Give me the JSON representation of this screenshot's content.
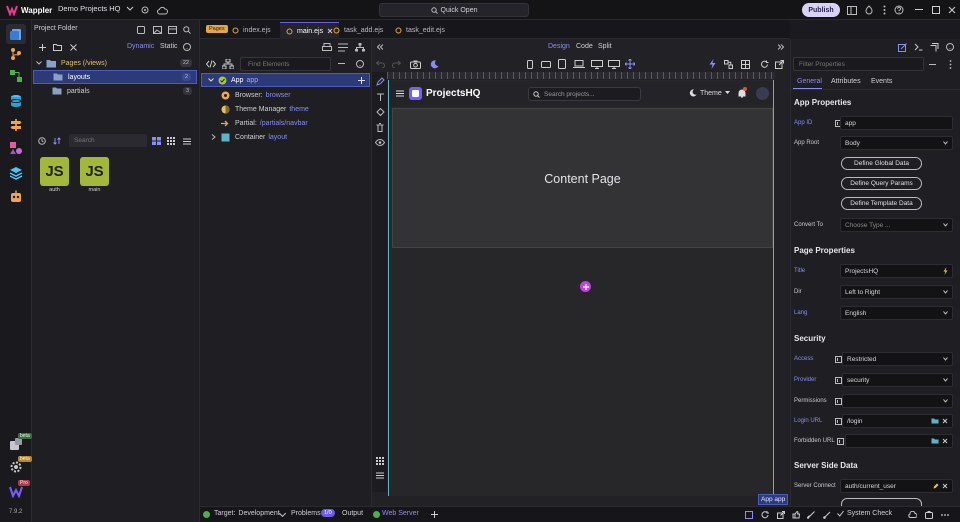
{
  "app": {
    "name": "Wappler",
    "project": "Demo Projects HQ",
    "quick_open": "Quick Open",
    "publish": "Publish",
    "version": "7.9.2"
  },
  "badges": {
    "beta1": "beta",
    "beta2": "beta",
    "pro": "Pro"
  },
  "project_panel": {
    "title": "Project Folder",
    "mode_dynamic": "Dynamic",
    "mode_static": "Static",
    "tree": [
      {
        "label": "Pages (/views)",
        "count": "22"
      },
      {
        "label": "layouts",
        "count": "2"
      },
      {
        "label": "partials",
        "count": "3"
      }
    ],
    "search_placeholder": "Search",
    "files": [
      {
        "badge": "JS",
        "name": "auth"
      },
      {
        "badge": "JS",
        "name": "main"
      }
    ]
  },
  "tabs": {
    "pages_badge": "Pages",
    "items": [
      {
        "label": "index.ejs"
      },
      {
        "label": "main.ejs"
      },
      {
        "label": "task_add.ejs"
      },
      {
        "label": "task_edit.ejs"
      }
    ]
  },
  "structure": {
    "find_placeholder": "Find Elements",
    "nodes": [
      {
        "label": "App",
        "name": "app"
      },
      {
        "label": "Browser:",
        "name": "browser"
      },
      {
        "label": "Theme Manager",
        "name": "theme"
      },
      {
        "label": "Partial:",
        "name": "/partials/navbar"
      },
      {
        "label": "Container",
        "name": "layout"
      }
    ]
  },
  "view_modes": {
    "design": "Design",
    "code": "Code",
    "split": "Split"
  },
  "canvas": {
    "brand": "ProjectsHQ",
    "search_placeholder": "Search projects...",
    "theme": "Theme",
    "content": "Content Page",
    "app_tag": "App app"
  },
  "properties": {
    "filter_placeholder": "Filter Properties",
    "tabs": [
      "General",
      "Attributes",
      "Events"
    ],
    "app_section": "App Properties",
    "app_id_label": "App ID",
    "app_id": "app",
    "app_root_label": "App Root",
    "app_root": "Body",
    "btn_global": "Define Global Data",
    "btn_query": "Define Query Params",
    "btn_template": "Define Template Data",
    "convert_label": "Convert To",
    "convert_placeholder": "Choose Type ...",
    "page_section": "Page Properties",
    "title_label": "Title",
    "title": "ProjectsHQ",
    "dir_label": "Dir",
    "dir": "Left to Right",
    "lang_label": "Lang",
    "lang": "English",
    "security_section": "Security",
    "access_label": "Access",
    "access": "Restricted",
    "provider_label": "Provider",
    "provider": "security",
    "permissions_label": "Permissions",
    "permissions": "",
    "login_label": "Login URL",
    "login": "/login",
    "forbidden_label": "Forbidden URL",
    "forbidden": "",
    "ssd_section": "Server Side Data",
    "server_connect_label": "Server Connect",
    "server_connect": "auth/current_user"
  },
  "statusbar": {
    "target_label": "Target:",
    "target": "Development",
    "problems": "Problems",
    "problems_count": "1/0",
    "output": "Output",
    "web_server": "Web Server",
    "system_check": "System Check"
  },
  "colors": {
    "accent": "#6c5ce7",
    "brand": "#7a5cff",
    "js_badge": "#a3b83a",
    "selected": "#2c3a78",
    "active_edge": "#5fb3c9"
  }
}
